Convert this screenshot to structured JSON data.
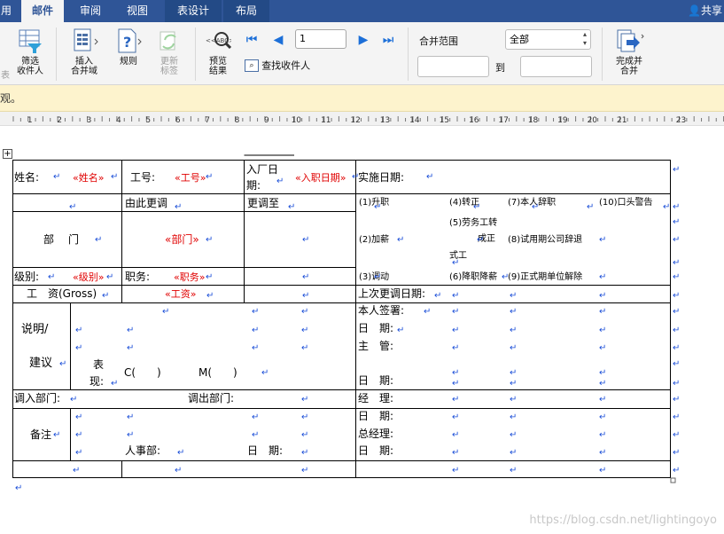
{
  "tabs": [
    {
      "label": "用",
      "active": false
    },
    {
      "label": "邮件",
      "active": true
    },
    {
      "label": "审阅",
      "active": false
    },
    {
      "label": "视图",
      "active": false
    },
    {
      "label": "表设计",
      "active": false
    },
    {
      "label": "布局",
      "active": false
    }
  ],
  "share_label": "共享",
  "ribbon": {
    "cut_label": "表",
    "filter_label": "筛选\n收件人",
    "insert_field_label": "插入\n合并域",
    "rules_label": "规则",
    "update_labels_label": "更新\n标签",
    "preview_label": "预览\n结果",
    "find_recipient_label": "查找收件人",
    "record_value": "1",
    "merge_range_label": "合并范围",
    "merge_range_value": "全部",
    "to_label": "到",
    "finish_merge_label": "完成并\n合并"
  },
  "message": "观。",
  "ruler": {
    "numbers": [
      "1",
      "2",
      "3",
      "4",
      "5",
      "6",
      "7",
      "8",
      "9",
      "10",
      "11",
      "12",
      "13",
      "14",
      "15",
      "16",
      "17",
      "18",
      "19",
      "20",
      "21",
      "23"
    ]
  },
  "form": {
    "name_label": "姓名:",
    "name_field": "«姓名»",
    "id_label": "工号:",
    "id_field": "«工号»",
    "join_label": "入厂日期:",
    "join_field": "«入职日期»",
    "impl_label": "实施日期:",
    "from_label": "由此更调",
    "to_label": "更调至",
    "dept_label": "部　门",
    "dept_field": "«部门»",
    "level_label": "级别:",
    "level_field": "«级别»",
    "post_label": "职务:",
    "post_field": "«职务»",
    "salary_label": "工　资(Gross)",
    "salary_field": "«工资»",
    "opt1": "(1)升职",
    "opt4": "(4)转正",
    "opt7": "(7)本人辞职",
    "opt10": "(10)口头警告",
    "opt5": "(5)劳务工转",
    "opt5b": "成正",
    "opt5c": "式工",
    "opt2": "(2)加薪",
    "opt8": "(8)试用期公司辞退",
    "opt3": "(3)调动",
    "opt6": "(6)降职降薪",
    "opt9": "(9)正式期单位解除",
    "last_change_label": "上次更调日期:",
    "note_label_1": "说明/",
    "note_label_2": "建议",
    "perf_label_1": "表",
    "perf_label_2": "现:",
    "c_label": "C(　　)",
    "m_label": "M(　　)",
    "sign_label": "本人签署:",
    "date_label": "日　期:",
    "supervisor_label": "主　管:",
    "manager_label": "经　理:",
    "gm_label": "总经理:",
    "in_dept_label": "调入部门:",
    "out_dept_label": "调出部门:",
    "remark_label": "备注",
    "hr_label": "人事部:",
    "hr_date_label": "日　期:"
  },
  "watermark": "https://blog.csdn.net/lightingoyo"
}
